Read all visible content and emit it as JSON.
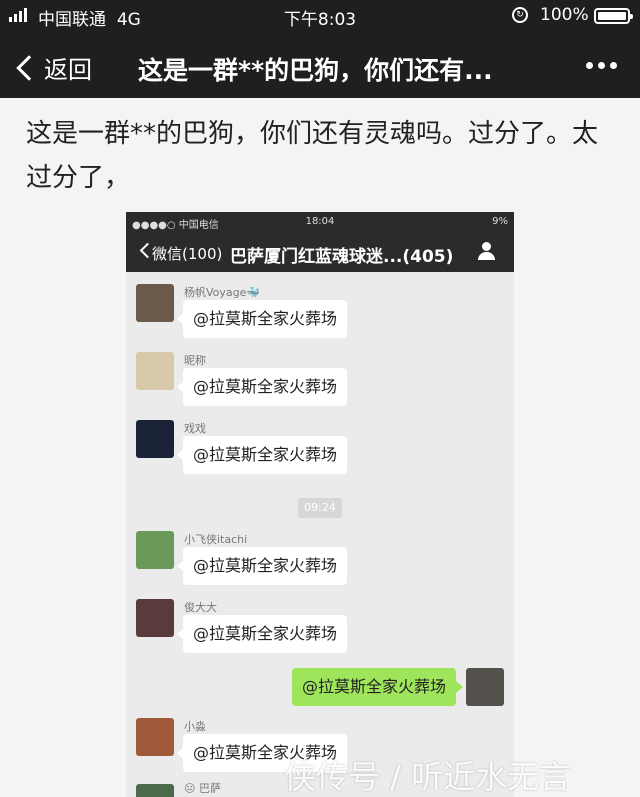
{
  "status_bar": {
    "carrier": "中国联通",
    "network": "4G",
    "time": "下午8:03",
    "battery": "100%"
  },
  "nav": {
    "back_label": "返回",
    "title": "这是一群**的巴狗，你们还有..."
  },
  "article": {
    "text": "这是一群**的巴狗，你们还有灵魂吗。过分了。太过分了，"
  },
  "embedded_screenshot": {
    "status_bar": {
      "carrier": "●●●●○ 中国电信 ",
      "time": "18:04",
      "battery": "9%"
    },
    "nav": {
      "back_label": "微信(100)",
      "title": "巴萨厦门红蓝魂球迷...(405)"
    },
    "messages": [
      {
        "sender": "杨帆Voyage🐳",
        "text": "@拉莫斯全家火葬场",
        "avatar_color": "#6b5a4a"
      },
      {
        "sender": "昵称",
        "text": "@拉莫斯全家火葬场",
        "avatar_color": "#d8c9a8"
      },
      {
        "sender": "戏戏",
        "text": "@拉莫斯全家火葬场",
        "avatar_color": "#1a2238"
      },
      {
        "sender": "小飞侠itachi",
        "text": "@拉莫斯全家火葬场",
        "avatar_color": "#6a9a5a"
      },
      {
        "sender": "俊大大",
        "text": "@拉莫斯全家火葬场",
        "avatar_color": "#5a3b3b"
      },
      {
        "sender": "小淼",
        "text": "@拉莫斯全家火葬场",
        "avatar_color": "#a05a3a"
      },
      {
        "sender": "😐 巴萨",
        "text": "",
        "avatar_color": "#4a6a4a"
      }
    ],
    "timestamp": "09:24",
    "outgoing": {
      "text": "@拉莫斯全家火葬场",
      "avatar_color": "#55524d"
    }
  },
  "watermark": "侠传号 / 听近水无言"
}
